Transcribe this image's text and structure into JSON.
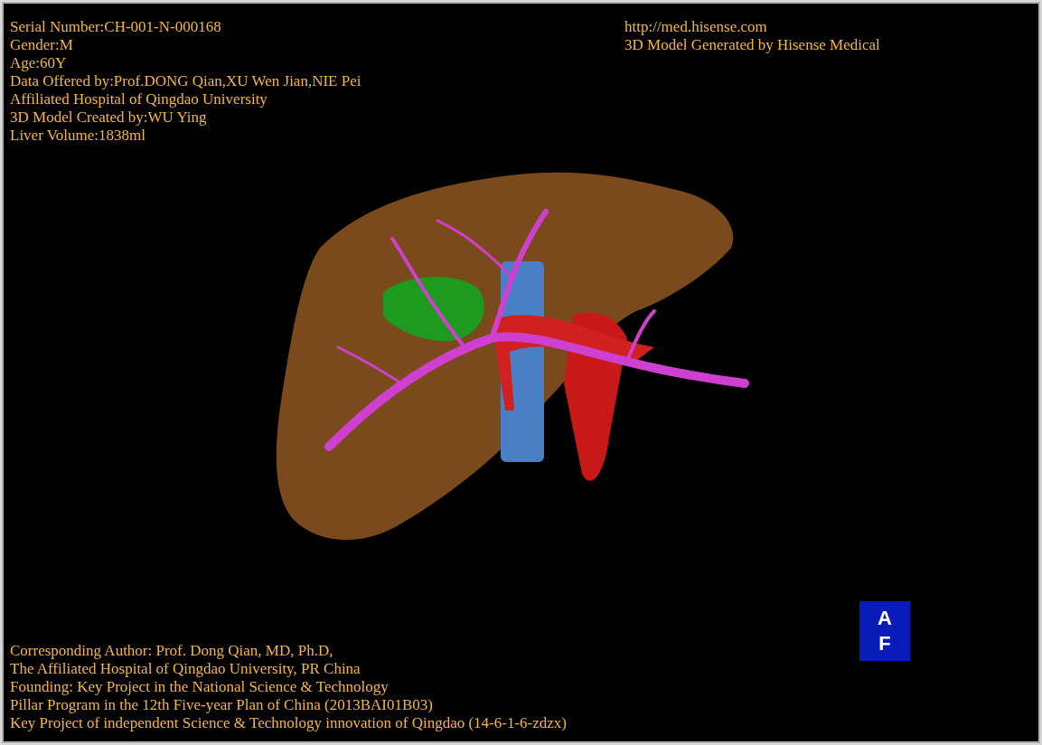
{
  "patient_info": [
    "Serial Number:CH-001-N-000168",
    "Gender:M",
    "Age:60Y",
    "Data Offered by:Prof.DONG Qian,XU Wen Jian,NIE Pei",
    "Affiliated Hospital of Qingdao University",
    "3D Model Created by:WU Ying",
    "Liver Volume:1838ml"
  ],
  "source_info": [
    "http://med.hisense.com",
    "3D Model Generated by Hisense Medical"
  ],
  "credits": [
    "Corresponding Author: Prof. Dong Qian, MD, Ph.D,",
    "The Affiliated Hospital of Qingdao University, PR China",
    "Founding: Key Project in the National Science & Technology",
    "Pillar Program in the 12th Five-year Plan of China (2013BAI01B03)",
    "Key Project of independent Science & Technology innovation of Qingdao (14-6-1-6-zdzx)"
  ],
  "orientation_cube": {
    "top_label": "A",
    "bottom_label": "F"
  }
}
